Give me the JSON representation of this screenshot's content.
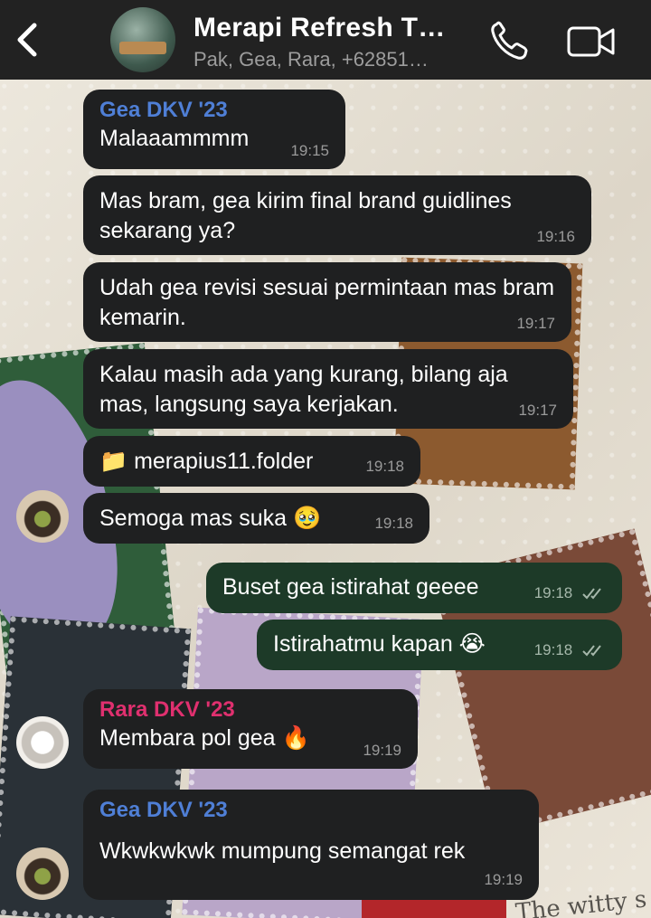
{
  "header": {
    "title": "Merapi Refresh T…",
    "subtitle": "Pak, Gea, Rara, +62851…",
    "back_icon": "chevron-left-icon",
    "call_icon": "phone-icon",
    "video_icon": "video-camera-icon"
  },
  "colors": {
    "header_bg": "#222222",
    "incoming_bubble": "#1f2021",
    "outgoing_bubble": "#1d3a28",
    "gea_name": "#4f7fd6",
    "rara_name": "#e0306f"
  },
  "messages": [
    {
      "sender": "Gea DKV '23",
      "text": "Malaaammmm",
      "time": "19:15"
    },
    {
      "text": "Mas bram, gea kirim final brand guidlines sekarang ya?",
      "time": "19:16"
    },
    {
      "text": "Udah gea revisi sesuai permintaan mas bram kemarin.",
      "time": "19:17"
    },
    {
      "text": "Kalau masih ada yang kurang, bilang aja mas, langsung saya kerjakan.",
      "time": "19:17"
    },
    {
      "text": "📁 merapius11.folder",
      "time": "19:18"
    },
    {
      "text": "Semoga mas suka 🥹",
      "time": "19:18"
    },
    {
      "text": "Buset gea istirahat geeee",
      "time": "19:18",
      "outgoing": true,
      "status": "read"
    },
    {
      "text": "Istirahatmu kapan 😭",
      "time": "19:18",
      "outgoing": true,
      "status": "read"
    },
    {
      "sender": "Rara DKV '23",
      "text": "Membara pol gea 🔥",
      "time": "19:19"
    },
    {
      "sender": "Gea DKV '23",
      "text": "Wkwkwkwk mumpung semangat rek",
      "time": "19:19"
    }
  ],
  "wallpaper": {
    "watermark": "The witty s"
  }
}
